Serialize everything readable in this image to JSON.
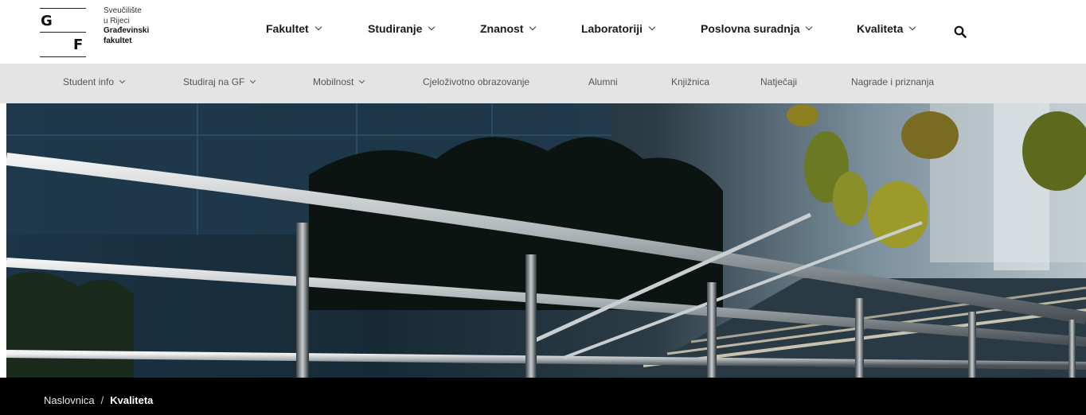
{
  "logo": {
    "letters": [
      "G",
      "F"
    ],
    "lines": [
      "Sveučilište",
      "u Rijeci",
      "Građevinski",
      "fakultet"
    ]
  },
  "main_nav": [
    {
      "label": "Fakultet",
      "has_dropdown": true
    },
    {
      "label": "Studiranje",
      "has_dropdown": true
    },
    {
      "label": "Znanost",
      "has_dropdown": true
    },
    {
      "label": "Laboratoriji",
      "has_dropdown": true
    },
    {
      "label": "Poslovna suradnja",
      "has_dropdown": true
    },
    {
      "label": "Kvaliteta",
      "has_dropdown": true
    }
  ],
  "search_icon": "search-icon",
  "sub_nav": [
    {
      "label": "Student info",
      "has_dropdown": true
    },
    {
      "label": "Studiraj na GF",
      "has_dropdown": true
    },
    {
      "label": "Mobilnost",
      "has_dropdown": true
    },
    {
      "label": "Cjeloživotno obrazovanje",
      "has_dropdown": false
    },
    {
      "label": "Alumni",
      "has_dropdown": false
    },
    {
      "label": "Knjižnica",
      "has_dropdown": false
    },
    {
      "label": "Natječaji",
      "has_dropdown": false
    },
    {
      "label": "Nagrade i priznanja",
      "has_dropdown": false
    }
  ],
  "breadcrumb": {
    "home": "Naslovnica",
    "separator": "/",
    "current": "Kvaliteta"
  },
  "colors": {
    "subnav_bg": "#e4e4e4",
    "breadcrumb_bg": "#000000"
  }
}
